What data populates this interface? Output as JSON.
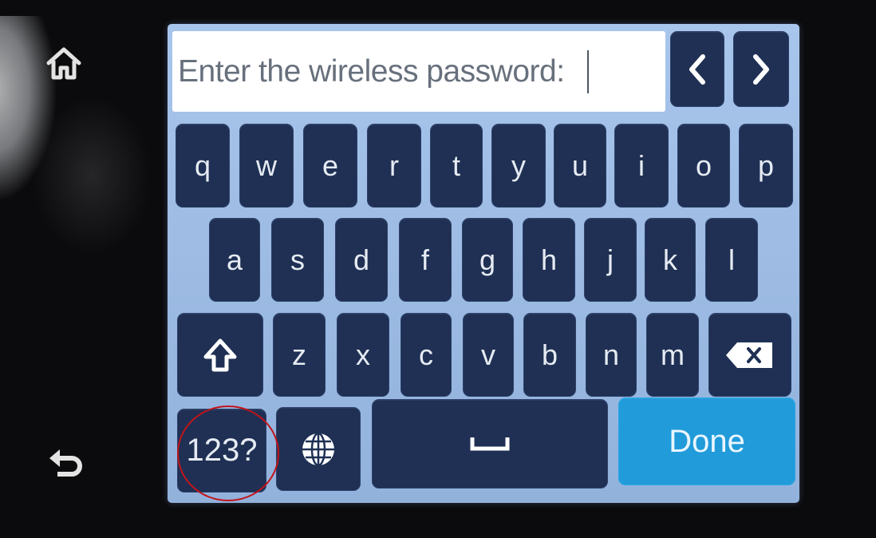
{
  "device": {
    "home_icon": "home-icon",
    "back_icon": "back-arrow-icon"
  },
  "password_field": {
    "prompt": "Enter the wireless password:"
  },
  "keyboard": {
    "row1": [
      "q",
      "w",
      "e",
      "r",
      "t",
      "y",
      "u",
      "i",
      "o",
      "p"
    ],
    "row2": [
      "a",
      "s",
      "d",
      "f",
      "g",
      "h",
      "j",
      "k",
      "l"
    ],
    "row3": [
      "z",
      "x",
      "c",
      "v",
      "b",
      "n",
      "m"
    ],
    "shift_icon": "shift-arrow-icon",
    "backspace_icon": "backspace-icon",
    "numbers_label": "123?",
    "language_icon": "globe-icon",
    "space_icon": "space-bar-icon",
    "done_label": "Done",
    "cursor_left_icon": "chevron-left-icon",
    "cursor_right_icon": "chevron-right-icon"
  },
  "colors": {
    "key": "#1f3054",
    "done": "#219bda",
    "screen": "#9dbbe3",
    "annotation": "#c2141b"
  }
}
